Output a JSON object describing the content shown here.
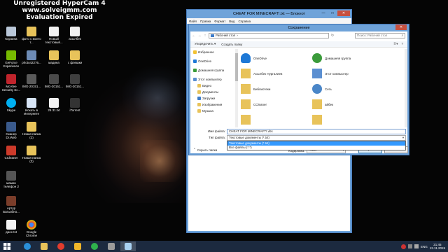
{
  "watermark": {
    "line1": "Unregistered HyperCam 4",
    "line2": "www.solveigmm.com",
    "line3": "Evaluation Expired"
  },
  "desktop_icons": [
    {
      "label": "Корзина"
    },
    {
      "label": "фото с моего т..."
    },
    {
      "label": "Новый текстовый..."
    },
    {
      "label": "асылбек"
    },
    {
      "label": "GeForce Experience"
    },
    {
      "label": "photo42276..."
    },
    {
      "label": "мадина"
    },
    {
      "label": "с флешки"
    },
    {
      "label": "McAfee Security Sc..."
    },
    {
      "label": "IMG-20151..."
    },
    {
      "label": "IMG-20151..."
    },
    {
      "label": "IMG-20151..."
    },
    {
      "label": "Skype"
    },
    {
      "label": "Искать в Интернете"
    },
    {
      "label": "25 31.txt"
    },
    {
      "label": "iTorrent"
    },
    {
      "label": "Сканер Dr.Web"
    },
    {
      "label": "Новая папка (2)"
    },
    {
      "label": "CCleaner"
    },
    {
      "label": "Новая папка (3)"
    },
    {
      "label": "мамин телефон 2"
    },
    {
      "label": "Артур Багызбно..."
    },
    {
      "label": "диос.txt"
    },
    {
      "label": "Google Chrome"
    }
  ],
  "notepad": {
    "title": "CHEAT FOR MINECRAFT!.txt — Блокнот",
    "menu": [
      "Файл",
      "Правка",
      "Формат",
      "Вид",
      "Справка"
    ],
    "min": "—",
    "max": "□",
    "close": "✕"
  },
  "dialog": {
    "title": "Сохранение",
    "close": "✕",
    "address": "Рабочий стол",
    "address_arrow": "›",
    "search_placeholder": "Поиск: Рабочий стол",
    "organize": "Упорядочить ▾",
    "new_folder": "Создать папку",
    "nav": [
      {
        "label": "Избранное"
      },
      {
        "label": "OneDrive"
      },
      {
        "label": "Домашняя группа"
      },
      {
        "label": "Этот компьютер"
      },
      {
        "label": "Видео"
      },
      {
        "label": "Документы"
      },
      {
        "label": "Загрузки"
      },
      {
        "label": "Изображения"
      },
      {
        "label": "Музыка"
      }
    ],
    "files": [
      {
        "label": "OneDrive"
      },
      {
        "label": "Домашняя группа"
      },
      {
        "label": "Асылбек Нургалиев"
      },
      {
        "label": "Этот компьютер"
      },
      {
        "label": "Библиотеки"
      },
      {
        "label": "Сеть"
      },
      {
        "label": "CCleaner"
      },
      {
        "label": "айбек"
      },
      {
        "label": ""
      },
      {
        "label": ""
      }
    ],
    "filename_label": "Имя файла:",
    "filename_value": "CHEAT FOR MINECRAFT!.vbs",
    "filetype_label": "Тип файла:",
    "filetype_value": "Текстовые документы (*.txt)",
    "dropdown_options": [
      "Текстовые документы (*.txt)",
      "Все файлы (*.*)"
    ],
    "hide_folders": "Скрыть папки",
    "encoding_label": "Кодировка:",
    "encoding_value": "ANSI",
    "save": "Сохранить",
    "cancel": "Отмена"
  },
  "taskbar": {
    "items": [
      "ie-icon",
      "explorer-icon",
      "yandex-icon",
      "store-icon",
      "agent-icon",
      "media-icon",
      "notepad-icon"
    ],
    "tray_lang": "ENG",
    "time": "21:45",
    "date": "13.11.2015"
  },
  "colors": {
    "window_frame": "#6fa3d9",
    "taskbar": "#1c2a3f",
    "close_red": "#c7503f",
    "selection": "#3399ff"
  }
}
